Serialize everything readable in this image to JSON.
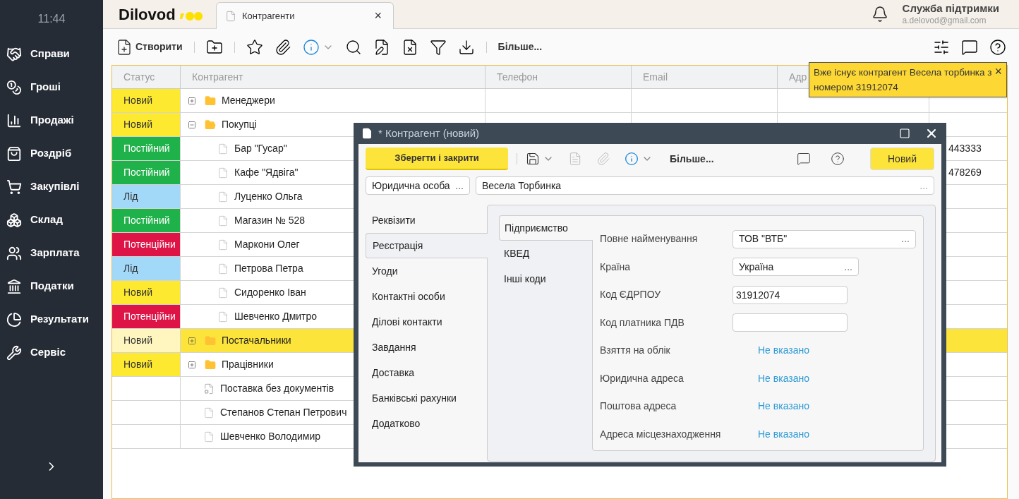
{
  "sidebar": {
    "time": "11:44",
    "items": [
      {
        "label": "Справи"
      },
      {
        "label": "Гроші"
      },
      {
        "label": "Продажі"
      },
      {
        "label": "Роздріб"
      },
      {
        "label": "Закупівлі"
      },
      {
        "label": "Склад"
      },
      {
        "label": "Зарплата"
      },
      {
        "label": "Податки"
      },
      {
        "label": "Результати"
      },
      {
        "label": "Сервіс"
      }
    ]
  },
  "header": {
    "logo": "Dilovod",
    "tab": {
      "label": "Контрагенти",
      "close": "×"
    },
    "user": {
      "name": "Служба підтримки",
      "email": "a.delovod@gmail.com"
    }
  },
  "toolbar": {
    "create": "Створити",
    "more": "Більше..."
  },
  "table": {
    "columns": [
      "Статус",
      "Контрагент",
      "Телефон",
      "Email",
      "Адр"
    ],
    "rows": [
      {
        "status": "Новий",
        "color": "#fde92f",
        "name": "Менеджери",
        "kind": "folder",
        "expanded": false,
        "selected": false
      },
      {
        "status": "Новий",
        "color": "#fde92f",
        "name": "Покупці",
        "kind": "folder",
        "expanded": true,
        "selected": false,
        "children": [
          {
            "status": "Постійний",
            "color": "#20b24a",
            "name": "Бар \"Гусар\"",
            "kind": "contact",
            "selected": false,
            "column_6": "443333"
          },
          {
            "status": "Постійний",
            "color": "#20b24a",
            "name": "Кафе \"Ядвіга\"",
            "kind": "contact",
            "selected": false,
            "column_6": "478269"
          },
          {
            "status": "Лід",
            "color": "#a3d9f8",
            "name": "Луценко Ольга",
            "kind": "contact",
            "selected": false
          },
          {
            "status": "Постійний",
            "color": "#20b24a",
            "name": "Магазин № 528",
            "kind": "contact",
            "selected": false
          },
          {
            "status": "Потенційни",
            "color": "#de1346",
            "name": "Маркони Олег",
            "kind": "contact",
            "selected": false
          },
          {
            "status": "Лід",
            "color": "#a3d9f8",
            "name": "Петрова Петра",
            "kind": "contact",
            "selected": false
          },
          {
            "status": "Новий",
            "color": "#fde92f",
            "name": "Сидоренко Іван",
            "kind": "contact",
            "selected": false
          },
          {
            "status": "Потенційни",
            "color": "#de1346",
            "name": "Шевченко Дмитро",
            "kind": "contact",
            "selected": false
          }
        ]
      },
      {
        "status": "Новий",
        "color": "#fff5bf",
        "name": "Постачальники",
        "kind": "folder",
        "expanded": false,
        "selected": true
      },
      {
        "status": "Новий",
        "color": "#fde92f",
        "name": "Працівники",
        "kind": "folder",
        "expanded": false,
        "selected": false
      },
      {
        "name": "Поставка без документів",
        "kind": "service",
        "selected": false
      },
      {
        "name": "Степанов Степан Петрович",
        "kind": "contact",
        "selected": false
      },
      {
        "name": "Шевченко Володимир",
        "kind": "contact",
        "selected": false
      }
    ]
  },
  "toast": {
    "text": "Вже існує контрагент Весела торбинка з номером 31912074",
    "close": "×"
  },
  "dialog": {
    "title": "* Контрагент (новий)",
    "save_close": "Зберегти і закрити",
    "more": "Більше...",
    "status_button": "Новий",
    "type_field": {
      "value": "Юридична особа",
      "button": "..."
    },
    "name_field": {
      "value": "Весела Торбинка",
      "button": "..."
    },
    "sections": [
      {
        "label": "Реквізити",
        "selected": false
      },
      {
        "label": "Реєстрація",
        "selected": true
      },
      {
        "label": "Угоди",
        "selected": false
      },
      {
        "label": "Контактні особи",
        "selected": false
      },
      {
        "label": "Ділові контакти",
        "selected": false
      },
      {
        "label": "Завдання",
        "selected": false
      },
      {
        "label": "Доставка",
        "selected": false
      },
      {
        "label": "Банківські рахунки",
        "selected": false
      },
      {
        "label": "Додатково",
        "selected": false
      }
    ],
    "subtabs": [
      {
        "label": "Підприємство",
        "selected": true
      },
      {
        "label": "КВЕД",
        "selected": false
      },
      {
        "label": "Інші коди",
        "selected": false
      }
    ],
    "fields": [
      {
        "label": "Повне найменування",
        "kind": "lookup",
        "value": "ТОВ \"ВТБ\"",
        "button": "..."
      },
      {
        "label": "Країна",
        "kind": "lookup",
        "value": "Україна",
        "button": "..."
      },
      {
        "label": "Код ЄДРПОУ",
        "kind": "text",
        "value": "31912074"
      },
      {
        "label": "Код платника ПДВ",
        "kind": "text"
      },
      {
        "label": "Взяття на облік",
        "kind": "link",
        "value": "Не вказано"
      },
      {
        "label": "Юридична адреса",
        "kind": "link",
        "value": "Не вказано"
      },
      {
        "label": "Поштова адреса",
        "kind": "link",
        "value": "Не вказано"
      },
      {
        "label": "Адреса місцезнаходження",
        "kind": "link",
        "value": "Не вказано"
      }
    ]
  }
}
